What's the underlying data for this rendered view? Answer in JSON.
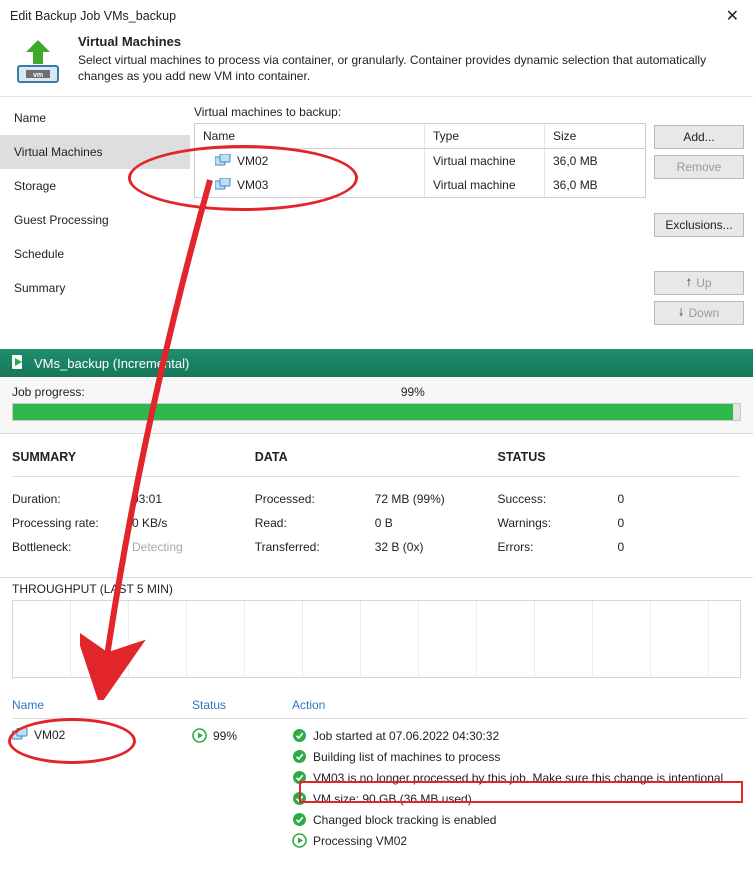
{
  "dialog": {
    "title": "Edit Backup Job VMs_backup",
    "heading": "Virtual Machines",
    "desc": "Select virtual machines to process via container, or granularly. Container provides dynamic selection that automatically changes as you add new VM into container.",
    "steps": [
      "Name",
      "Virtual Machines",
      "Storage",
      "Guest Processing",
      "Schedule",
      "Summary"
    ],
    "active_step": 1,
    "vm_label": "Virtual machines to backup:",
    "columns": {
      "name": "Name",
      "type": "Type",
      "size": "Size"
    },
    "rows": [
      {
        "name": "VM02",
        "type": "Virtual machine",
        "size": "36,0 MB"
      },
      {
        "name": "VM03",
        "type": "Virtual machine",
        "size": "36,0 MB"
      }
    ],
    "buttons": {
      "add": "Add...",
      "remove": "Remove",
      "exclusions": "Exclusions...",
      "up": "Up",
      "down": "Down"
    }
  },
  "job": {
    "title": "VMs_backup (Incremental)",
    "progress_label": "Job progress:",
    "progress_pct": "99%",
    "summary_h": "SUMMARY",
    "data_h": "DATA",
    "status_h": "STATUS",
    "summary": {
      "duration_k": "Duration:",
      "duration_v": "03:01",
      "rate_k": "Processing rate:",
      "rate_v": "0 KB/s",
      "bottleneck_k": "Bottleneck:",
      "bottleneck_v": "Detecting"
    },
    "data": {
      "processed_k": "Processed:",
      "processed_v": "72 MB (99%)",
      "read_k": "Read:",
      "read_v": "0 B",
      "transferred_k": "Transferred:",
      "transferred_v": "32 B (0x)"
    },
    "status": {
      "success_k": "Success:",
      "success_v": "0",
      "warnings_k": "Warnings:",
      "warnings_v": "0",
      "errors_k": "Errors:",
      "errors_v": "0"
    },
    "throughput_label": "THROUGHPUT (LAST 5 MIN)",
    "detail_headers": {
      "name": "Name",
      "status": "Status",
      "action": "Action"
    },
    "detail_vm": {
      "name": "VM02",
      "status": "99%"
    },
    "actions": [
      "Job started at 07.06.2022 04:30:32",
      "Building list of machines to process",
      "VM03 is no longer processed by this job. Make sure this change is intentional",
      "VM size: 90 GB (36 MB used)",
      "Changed block tracking is enabled",
      "Processing VM02"
    ]
  }
}
